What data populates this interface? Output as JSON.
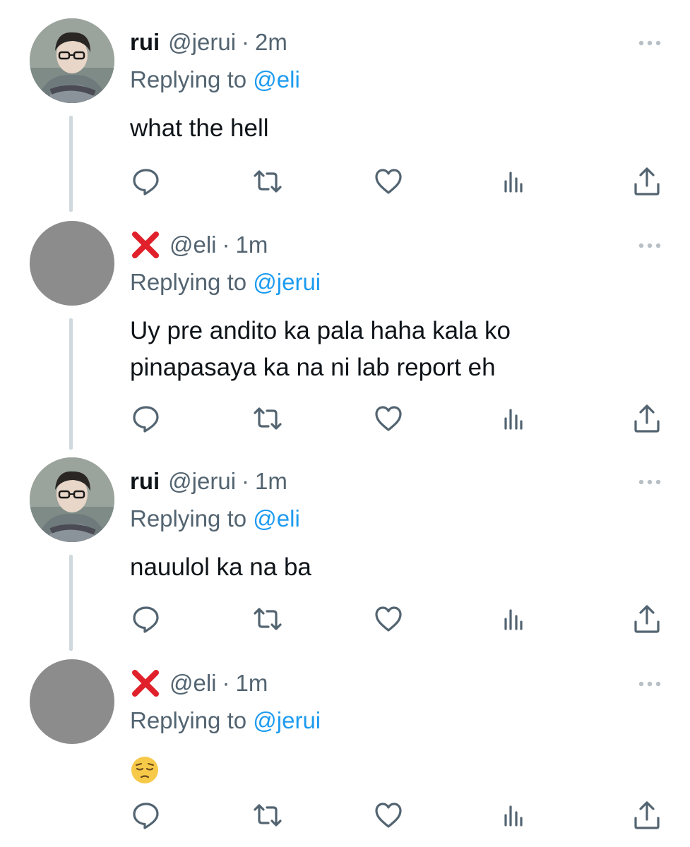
{
  "tweets": [
    {
      "author_name": "rui",
      "handle": "@jerui",
      "separator": "·",
      "time": "2m",
      "replying_prefix": "Replying to",
      "replying_to": "@eli",
      "lines": [
        "what the hell"
      ],
      "avatar": "photo"
    },
    {
      "author_name": "❌",
      "handle": "@eli",
      "separator": "·",
      "time": "1m",
      "replying_prefix": "Replying to",
      "replying_to": "@jerui",
      "lines": [
        "Uy pre andito ka pala haha kala ko",
        "pinapasaya ka na ni lab report eh"
      ],
      "avatar": "gray"
    },
    {
      "author_name": "rui",
      "handle": "@jerui",
      "separator": "·",
      "time": "1m",
      "replying_prefix": "Replying to",
      "replying_to": "@eli",
      "lines": [
        "nauulol ka na ba"
      ],
      "avatar": "photo"
    },
    {
      "author_name": "❌",
      "handle": "@eli",
      "separator": "·",
      "time": "1m",
      "replying_prefix": "Replying to",
      "replying_to": "@jerui",
      "lines": [
        "😔"
      ],
      "avatar": "gray"
    }
  ],
  "icons": {
    "reply": "reply-icon",
    "retweet": "retweet-icon",
    "like": "like-icon",
    "views": "views-icon",
    "share": "share-icon",
    "more": "more-icon"
  },
  "colors": {
    "text": "#0f1419",
    "secondary": "#536471",
    "mention": "#1d9bf0",
    "thread_line": "#cfd9de",
    "x_mark": "#e0212c",
    "avatar_gray": "#8c8c8c"
  }
}
